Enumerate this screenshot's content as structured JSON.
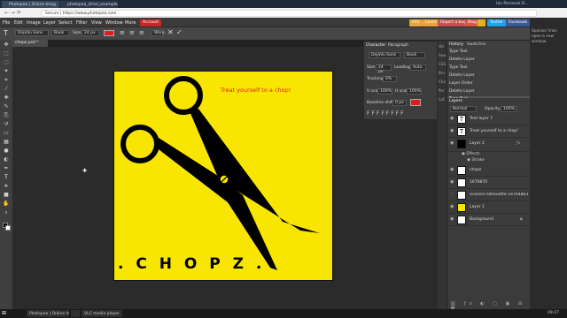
{
  "browser": {
    "tabs": [
      {
        "label": "Photopea | Online Imag"
      },
      {
        "label": "photopea_drive_examples"
      }
    ],
    "url": "Secure | https://www.photopea.com",
    "profile": "Ian Personal D..."
  },
  "menubar": {
    "items": [
      "File",
      "Edit",
      "Image",
      "Layer",
      "Select",
      "Filter",
      "View",
      "Window",
      "More"
    ],
    "account": "Account",
    "buttons": [
      {
        "label": "Info",
        "color": "#e8a33a"
      },
      {
        "label": "Learn",
        "color": "#e8a33a"
      },
      {
        "label": "Report a bug",
        "color": "#c94f4f"
      },
      {
        "label": "Blog",
        "color": "#d9573f"
      },
      {
        "label": "Twitter",
        "color": "#1da1f2"
      },
      {
        "label": "Facebook",
        "color": "#3b5998"
      }
    ],
    "sponsor": "Sponsor links open a new window."
  },
  "options": {
    "font": "DejaVu Sans",
    "style": "Book",
    "size_label": "Size",
    "size": "24 px",
    "warp": "Warp",
    "text_color": "#e31b1b"
  },
  "doc_tab": "chopz.psd *",
  "document": {
    "tagline": "Treat yourself to a chop!",
    "title": ". C H O P Z .",
    "bg": "#f8e600"
  },
  "character": {
    "tabs": [
      "Character",
      "Paragraph"
    ],
    "font": "DejaVu Sans",
    "style": "Book",
    "size_label": "Size",
    "size": "24 px",
    "leading_label": "Leading",
    "leading": "Auto",
    "tracking_label": "Tracking",
    "tracking": "0%",
    "vscale_label": "V scale",
    "vscale": "100%",
    "hscale_label": "H scale",
    "hscale": "100%",
    "baseline_label": "Baseline shift",
    "baseline": "0 px",
    "color": "#e31b1b"
  },
  "history": {
    "tabs": [
      "History",
      "Swatches"
    ],
    "items": [
      "Type Tool",
      "Delete Layer",
      "Type Tool",
      "Delete Layer",
      "Layer Order",
      "Delete Layer",
      "Type Tool"
    ]
  },
  "layers": {
    "title": "Layers",
    "blend": "Normal",
    "opacity_label": "Opacity",
    "opacity": "100%",
    "items": [
      {
        "name": "Text layer 7",
        "thumb": "T"
      },
      {
        "name": "Treat yourself to a chop!",
        "thumb": "T"
      },
      {
        "name": "Layer 2",
        "thumb": ""
      },
      {
        "name": "Effects",
        "thumb": ""
      },
      {
        "name": "Stroke",
        "thumb": ""
      },
      {
        "name": "chopz",
        "thumb": ""
      },
      {
        "name": "1679870",
        "thumb": ""
      },
      {
        "name": "scissors-silhouette-14764863",
        "thumb": ""
      },
      {
        "name": "Layer 1",
        "thumb": ""
      },
      {
        "name": "Background",
        "thumb": ""
      }
    ]
  },
  "taskbar": {
    "items": [
      "Photopea | Online Im...",
      "",
      "VLC media player"
    ],
    "time": "09:27"
  }
}
